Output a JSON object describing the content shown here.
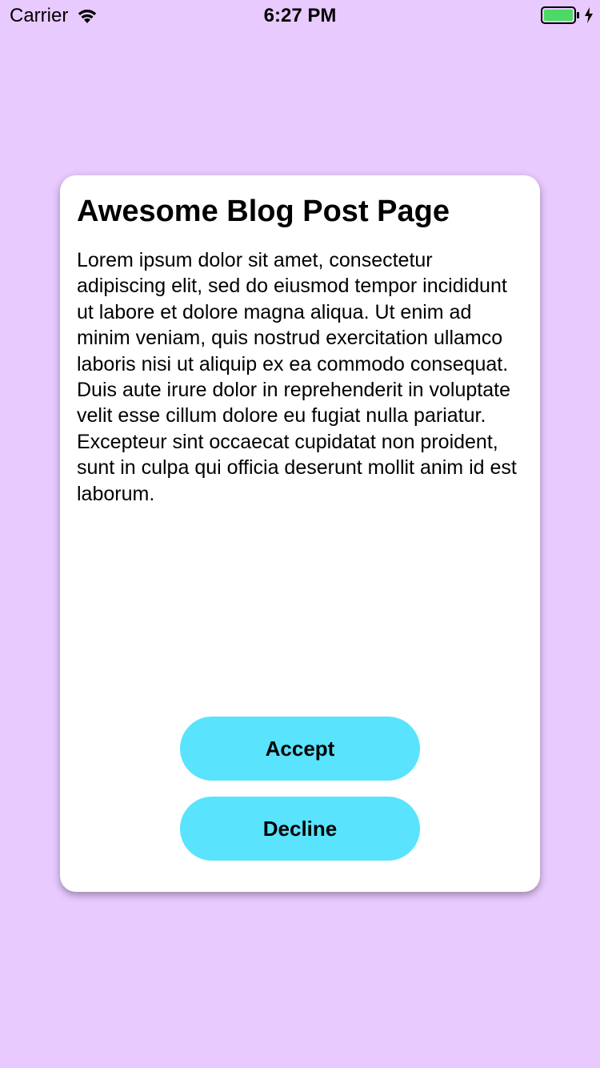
{
  "status_bar": {
    "carrier": "Carrier",
    "time": "6:27 PM",
    "wifi_icon": "wifi-icon",
    "battery_icon": "battery-icon",
    "battery_color": "#4cd964"
  },
  "card": {
    "title": "Awesome Blog Post Page",
    "body": "Lorem ipsum dolor sit amet, consectetur adipiscing elit, sed do eiusmod tempor incididunt ut labore et dolore magna aliqua. Ut enim ad minim veniam, quis nostrud exercitation ullamco laboris nisi ut aliquip ex ea commodo consequat. Duis aute irure dolor in reprehenderit in voluptate velit esse cillum dolore eu fugiat nulla pariatur. Excepteur sint occaecat cupidatat non proident, sunt in culpa qui officia deserunt mollit anim id est laborum.",
    "accept_label": "Accept",
    "decline_label": "Decline"
  },
  "colors": {
    "background": "#e8caff",
    "card": "#ffffff",
    "button": "#59e3fd"
  }
}
